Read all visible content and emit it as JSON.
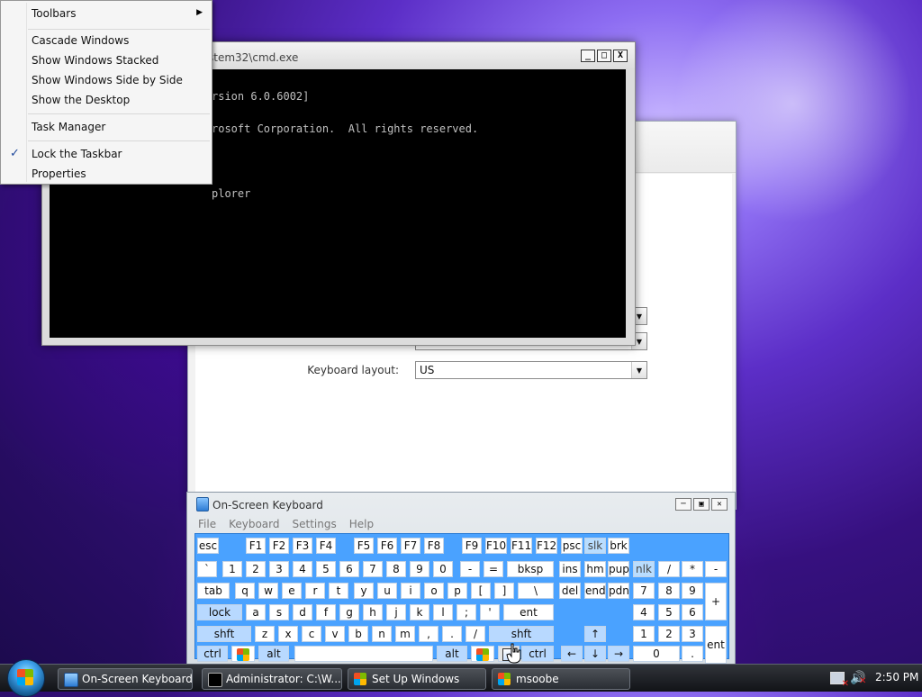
{
  "context_menu": {
    "items": [
      {
        "label": "Toolbars"
      },
      {
        "label": "Cascade Windows"
      },
      {
        "label": "Show Windows Stacked"
      },
      {
        "label": "Show Windows Side by Side"
      },
      {
        "label": "Show the Desktop"
      },
      {
        "label": "Task Manager"
      },
      {
        "label": "Lock the Taskbar",
        "checked": true
      },
      {
        "label": "Properties"
      }
    ]
  },
  "cmd_window": {
    "title": "stem32\\cmd.exe",
    "lines": [
      "rsion 6.0.6002]",
      "rosoft Corporation.  All rights reserved.",
      "",
      "plorer"
    ],
    "controls": {
      "minimize": "_",
      "maximize": "□",
      "close": "X"
    }
  },
  "setup_window": {
    "keyboard_layout_label": "Keyboard layout:",
    "keyboard_layout_value": "US"
  },
  "osk": {
    "title": "On-Screen Keyboard",
    "menu": [
      "File",
      "Keyboard",
      "Settings",
      "Help"
    ],
    "controls": {
      "minimize": "─",
      "restore": "▣",
      "close": "✕"
    },
    "keys": {
      "row1": [
        "esc",
        "F1",
        "F2",
        "F3",
        "F4",
        "F5",
        "F6",
        "F7",
        "F8",
        "F9",
        "F10",
        "F11",
        "F12",
        "psc",
        "slk",
        "brk"
      ],
      "row2": [
        "`",
        "1",
        "2",
        "3",
        "4",
        "5",
        "6",
        "7",
        "8",
        "9",
        "0",
        "-",
        "=",
        "bksp",
        "ins",
        "hm",
        "pup",
        "nlk",
        "/",
        "*",
        "-"
      ],
      "row3": [
        "tab",
        "q",
        "w",
        "e",
        "r",
        "t",
        "y",
        "u",
        "i",
        "o",
        "p",
        "[",
        "]",
        "\\",
        "del",
        "end",
        "pdn",
        "7",
        "8",
        "9",
        "+"
      ],
      "row4": [
        "lock",
        "a",
        "s",
        "d",
        "f",
        "g",
        "h",
        "j",
        "k",
        "l",
        ";",
        "'",
        "ent",
        "4",
        "5",
        "6"
      ],
      "row5": [
        "shft",
        "z",
        "x",
        "c",
        "v",
        "b",
        "n",
        "m",
        ",",
        ".",
        "/",
        "shft",
        "↑",
        "1",
        "2",
        "3"
      ],
      "row6": [
        "ctrl",
        "alt",
        "alt",
        "ctrl",
        "←",
        "↓",
        "→",
        "0",
        ".",
        "ent"
      ]
    }
  },
  "taskbar": {
    "buttons": [
      {
        "label": "On-Screen Keyboard"
      },
      {
        "label": "Administrator: C:\\W..."
      },
      {
        "label": "Set Up Windows"
      },
      {
        "label": "msoobe"
      }
    ],
    "clock": "2:50 PM"
  }
}
